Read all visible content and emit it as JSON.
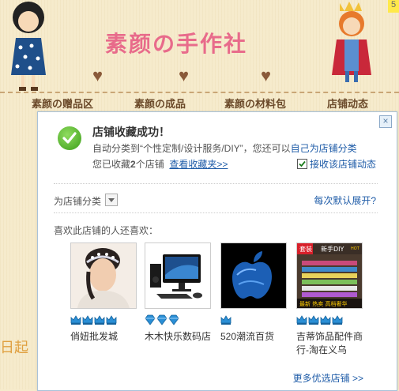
{
  "shop_banner": {
    "title": "素颜の手作社",
    "nav": [
      "素颜の赠品区",
      "素颜の成品",
      "素颜の材料包",
      "店铺动态"
    ],
    "left_partial_text": "日起",
    "corner_tag": "5"
  },
  "popup": {
    "title": "店铺收藏成功！",
    "line1_prefix": "自动分类到“个性定制/设计服务/DIY”，您还可以",
    "line1_link": "自己为店铺分类",
    "line2_prefix": "您已收藏",
    "line2_count": "2",
    "line2_suffix": "个店铺",
    "view_favorites": "查看收藏夹>>",
    "subscribe_label": "接收该店铺动态",
    "subscribe_checked": true,
    "category_label": "为店铺分类",
    "expand_default": "每次默认展开?",
    "also_like_title": "喜欢此店铺的人还喜欢：",
    "shops": [
      {
        "name": "俏妞批发城",
        "badge_type": "crown",
        "badge_count": 4
      },
      {
        "name": "木木快乐数码店",
        "badge_type": "diamond",
        "badge_count": 3
      },
      {
        "name": "520潮流百货",
        "badge_type": "crown",
        "badge_count": 1
      },
      {
        "name": "吉蒂饰品配件商行-淘在义乌",
        "badge_type": "crown",
        "badge_count": 4
      }
    ],
    "thumb4_text": {
      "top_left": "套装",
      "top_right": "新手DIY",
      "hot": "HOT",
      "bottom": "最新 热卖 高档奢华"
    },
    "more_shops": "更多优选店铺 >>",
    "colors": {
      "link": "#1f5ca8",
      "badge_blue": "#2a8fd6",
      "success_green": "#3c9e1a"
    }
  }
}
